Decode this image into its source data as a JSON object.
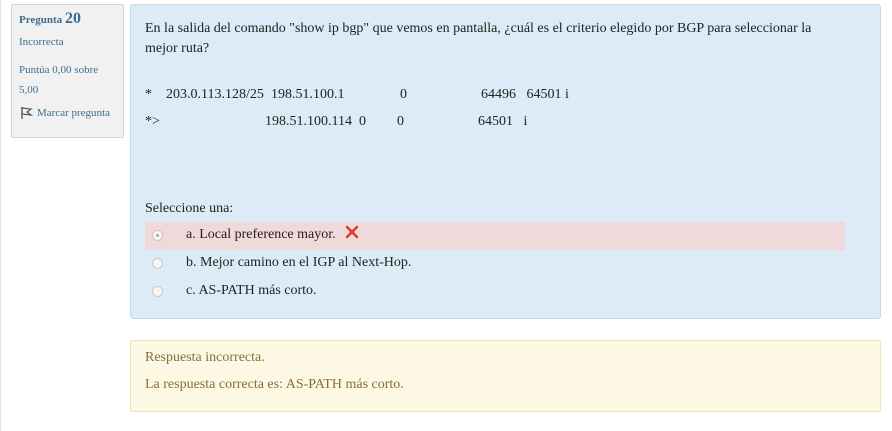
{
  "info": {
    "question_label": "Pregunta",
    "question_number": "20",
    "state": "Incorrecta",
    "grade": "Puntúa 0,00 sobre 5,00",
    "flag_label": "Marcar pregunta"
  },
  "question": {
    "text": "En la salida del comando \"show ip bgp\" que vemos en pantalla, ¿cuál es el criterio elegido por BGP para seleccionar la mejor ruta?",
    "row1": {
      "status": "*",
      "network": "203.0.113.128/25",
      "next_hop": "198.51.100.1",
      "metric": "0",
      "path": "64496   64501 i"
    },
    "row2": {
      "status": "*>",
      "next_hop": "198.51.100.114",
      "metric": "0",
      "locprf": "0",
      "path": "64501   i"
    },
    "prompt": "Seleccione una:",
    "answers": [
      {
        "label": "a. Local preference mayor.",
        "selected": true,
        "state": "incorrect"
      },
      {
        "label": "b. Mejor camino en el IGP al Next-Hop.",
        "selected": false
      },
      {
        "label": "c. AS-PATH más corto.",
        "selected": false
      }
    ]
  },
  "feedback": {
    "status": "Respuesta incorrecta.",
    "right_answer": "La respuesta correcta es: AS-PATH más corto."
  },
  "colors": {
    "question_bg": "#dcebf5",
    "incorrect_bg": "#efd9da",
    "feedback_bg": "#fcf8e3",
    "x_mark": "#e03131"
  }
}
